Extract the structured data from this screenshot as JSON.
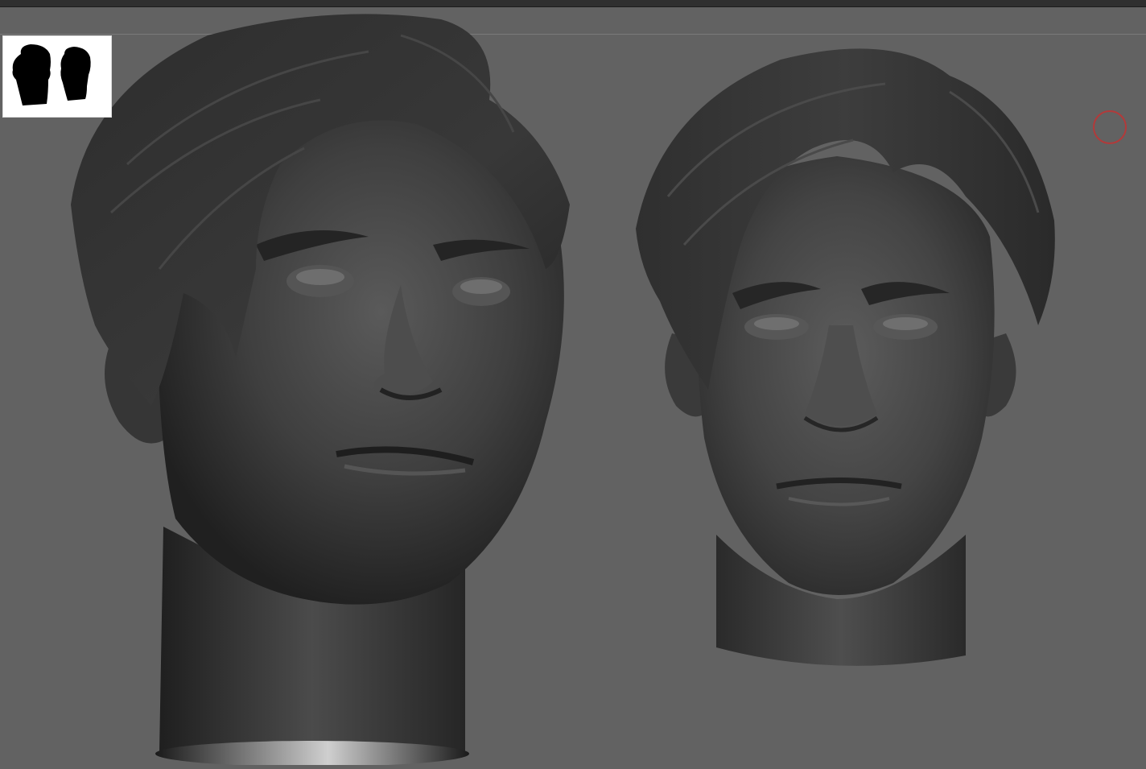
{
  "viewport": {
    "background_color": "#626262",
    "mesh_color": "#3c3c3c",
    "thumbnail_background": "#ffffff",
    "thumbnail_silhouette_color": "#000000",
    "brush_cursor_color": "#b23a3a"
  },
  "thumbnail": {
    "icon": "head-silhouette-pair-icon"
  },
  "meshes": [
    {
      "name": "head-three-quarter-view",
      "icon": "sculpted-head"
    },
    {
      "name": "head-front-view",
      "icon": "sculpted-head"
    }
  ],
  "cursor": {
    "icon": "brush-circle-icon"
  }
}
